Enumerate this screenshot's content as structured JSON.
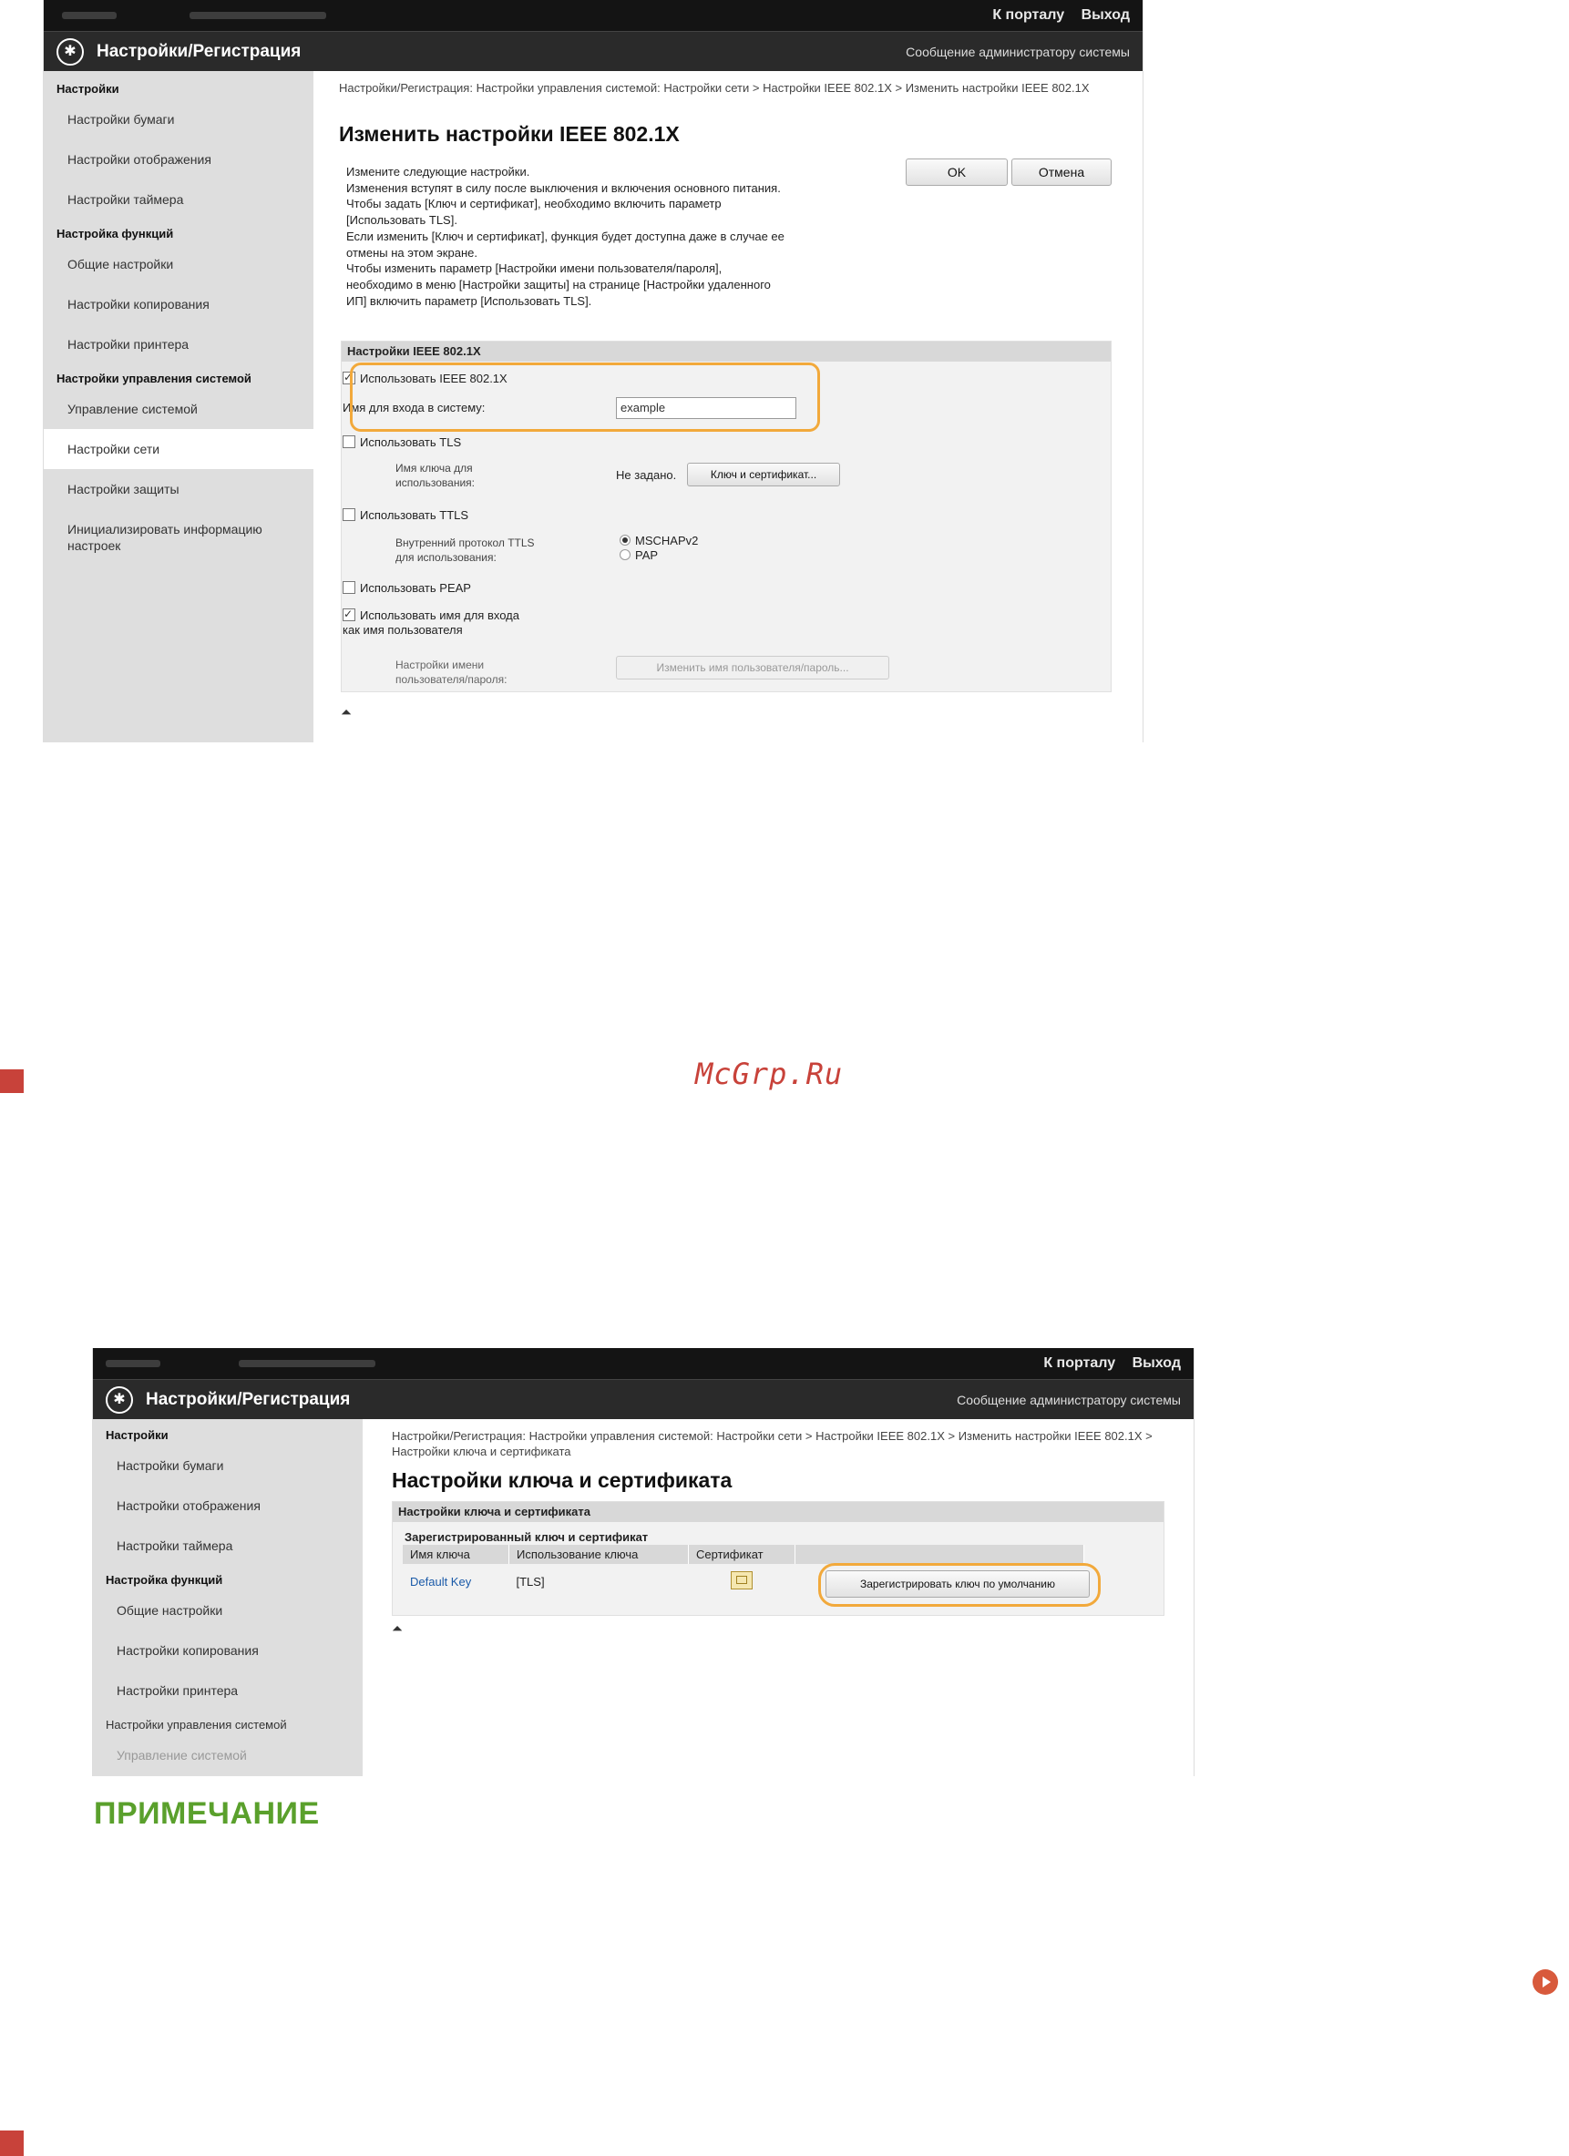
{
  "screenshot1": {
    "topbar": {
      "portal_link": "К порталу",
      "logout_link": "Выход"
    },
    "titlebar": {
      "app_title": "Настройки/Регистрация",
      "admin_message": "Сообщение администратору системы"
    },
    "sidebar": {
      "groups": [
        {
          "label": "Настройки",
          "items": [
            "Настройки бумаги",
            "Настройки отображения",
            "Настройки таймера"
          ]
        },
        {
          "label": "Настройка функций",
          "items": [
            "Общие настройки",
            "Настройки копирования",
            "Настройки принтера"
          ]
        },
        {
          "label": "Настройки управления системой",
          "items": [
            "Управление системой",
            "Настройки сети",
            "Настройки защиты",
            "Инициализировать информацию настроек"
          ]
        }
      ]
    },
    "breadcrumb": "Настройки/Регистрация: Настройки управления системой: Настройки сети > Настройки IEEE 802.1X > Изменить настройки IEEE 802.1X",
    "page_title": "Изменить настройки IEEE 802.1X",
    "info_lines": [
      "Измените следующие настройки.",
      "Изменения вступят в силу после выключения и включения основного питания.",
      "Чтобы задать [Ключ и сертификат], необходимо включить параметр",
      "[Использовать TLS].",
      "Если изменить [Ключ и сертификат], функция будет доступна даже в случае ее",
      "отмены на этом экране.",
      "Чтобы изменить параметр [Настройки имени пользователя/пароля],",
      "необходимо в меню [Настройки защиты] на странице [Настройки удаленного",
      "ИП] включить параметр [Использовать TLS]."
    ],
    "ok_button": "OK",
    "cancel_button": "Отмена",
    "panel_header": "Настройки IEEE 802.1X",
    "use_ieee_label": "Использовать IEEE 802.1X",
    "login_name_label": "Имя для входа в систему:",
    "login_name_value": "example",
    "use_tls_label": "Использовать TLS",
    "key_name_label_1": "Имя ключа для",
    "key_name_label_2": "использования:",
    "key_name_value": "Не задано.",
    "key_cert_button": "Ключ и сертификат...",
    "use_ttls_label": "Использовать TTLS",
    "ttls_protocol_label_1": "Внутренний протокол TTLS",
    "ttls_protocol_label_2": "для использования:",
    "ttls_options": [
      "MSCHAPv2",
      "PAP"
    ],
    "use_peap_label": "Использовать PEAP",
    "use_login_as_user_1": "Использовать имя для входа",
    "use_login_as_user_2": "как имя пользователя",
    "user_pass_settings_label_1": "Настройки имени",
    "user_pass_settings_label_2": "пользователя/пароля:",
    "change_user_pass_button": "Изменить имя пользователя/пароль..."
  },
  "watermark": "McGrp.Ru",
  "screenshot2": {
    "topbar": {
      "portal_link": "К порталу",
      "logout_link": "Выход"
    },
    "titlebar": {
      "app_title": "Настройки/Регистрация",
      "admin_message": "Сообщение администратору системы"
    },
    "sidebar": {
      "groups": [
        {
          "label": "Настройки",
          "items": [
            "Настройки бумаги",
            "Настройки отображения",
            "Настройки таймера"
          ]
        },
        {
          "label": "Настройка функций",
          "items": [
            "Общие настройки",
            "Настройки копирования",
            "Настройки принтера"
          ]
        },
        {
          "label": "Настройки управления системой",
          "items": [
            "Управление системой"
          ]
        }
      ]
    },
    "breadcrumb": "Настройки/Регистрация: Настройки управления системой: Настройки сети > Настройки IEEE 802.1X > Изменить настройки IEEE 802.1X > Настройки ключа и сертификата",
    "page_title": "Настройки ключа и сертификата",
    "panel_header": "Настройки ключа и сертификата",
    "table_caption": "Зарегистрированный ключ и сертификат",
    "table_headers": [
      "Имя ключа",
      "Использование ключа",
      "Сертификат"
    ],
    "table_row": {
      "key_name": "Default Key",
      "key_usage": "[TLS]"
    },
    "register_default_button": "Зарегистрировать ключ по умолчанию"
  },
  "note_heading": "ПРИМЕЧАНИЕ",
  "colors": {
    "highlight": "#f2a93b",
    "note": "#5aa02c",
    "accent_red": "#c8423a"
  }
}
